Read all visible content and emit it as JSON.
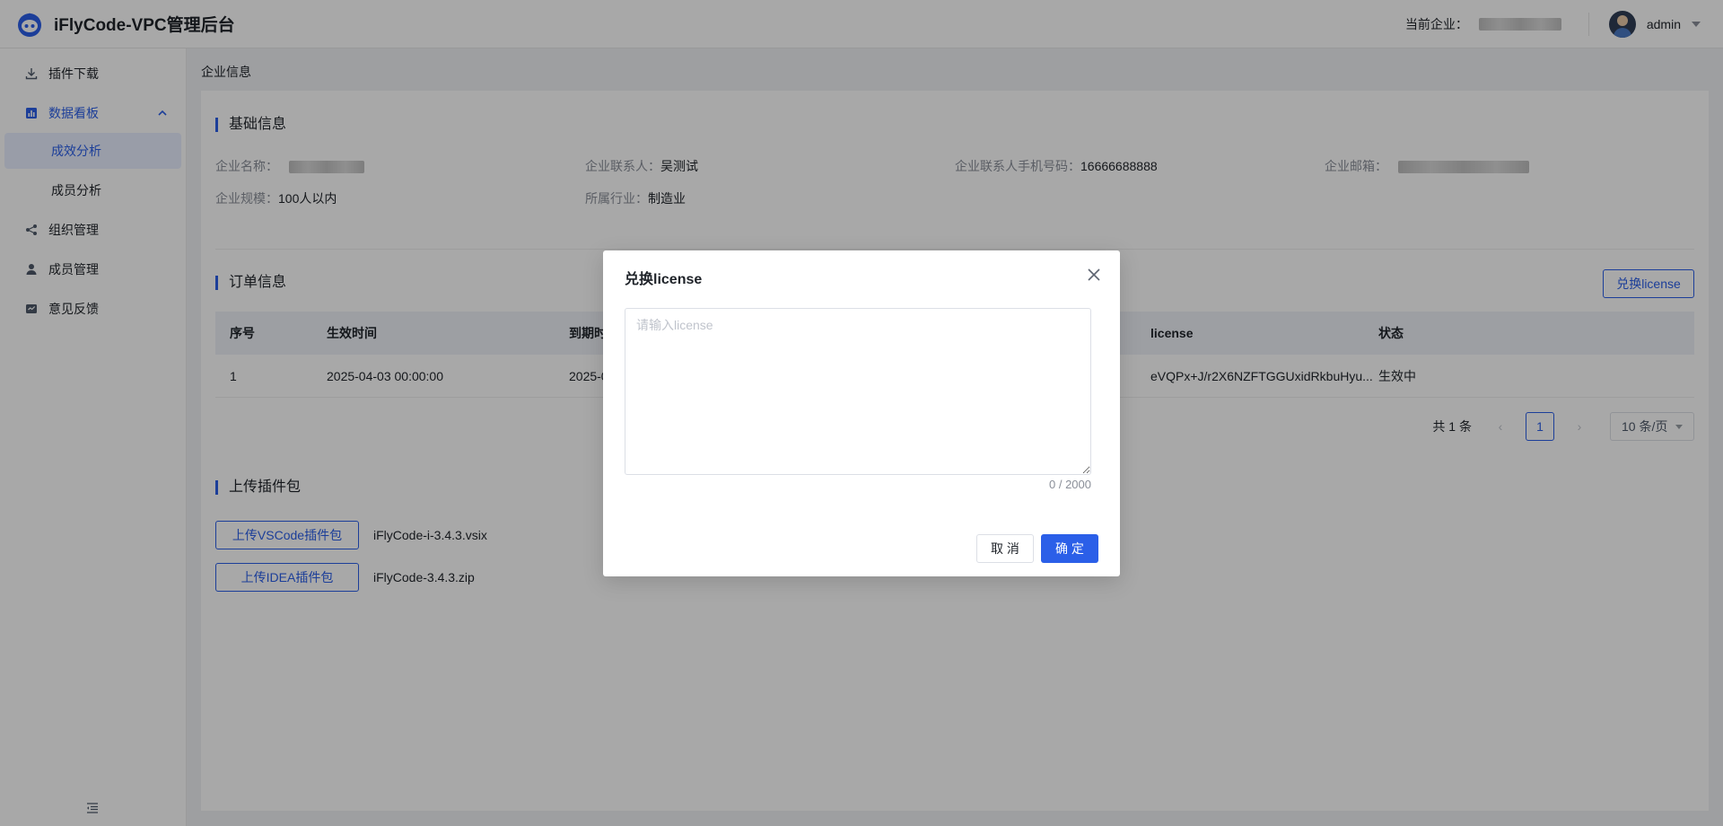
{
  "header": {
    "app_title": "iFlyCode-VPC管理后台",
    "company_label": "当前企业：",
    "user_name": "admin"
  },
  "sidebar": {
    "items": [
      {
        "label": "插件下载",
        "icon": "download-icon"
      },
      {
        "label": "数据看板",
        "icon": "chart-icon",
        "expanded": true,
        "children": [
          {
            "label": "成效分析",
            "active": true
          },
          {
            "label": "成员分析",
            "active": false
          }
        ]
      },
      {
        "label": "组织管理",
        "icon": "share-icon"
      },
      {
        "label": "成员管理",
        "icon": "user-icon"
      },
      {
        "label": "意见反馈",
        "icon": "feedback-icon"
      }
    ]
  },
  "breadcrumb": "企业信息",
  "basic_info": {
    "title": "基础信息",
    "fields": [
      {
        "label": "企业名称：",
        "value": ""
      },
      {
        "label": "企业联系人：",
        "value": "吴测试"
      },
      {
        "label": "企业联系人手机号码：",
        "value": "16666688888"
      },
      {
        "label": "企业邮箱：",
        "value": ""
      },
      {
        "label": "企业规模：",
        "value": "100人以内"
      },
      {
        "label": "所属行业：",
        "value": "制造业"
      }
    ]
  },
  "order_info": {
    "title": "订单信息",
    "redeem_button": "兑换license",
    "columns": [
      "序号",
      "生效时间",
      "到期时",
      "license",
      "状态"
    ],
    "rows": [
      {
        "index": "1",
        "start": "2025-04-03 00:00:00",
        "end": "2025-0",
        "license": "eVQPx+J/r2X6NZFTGGUxidRkbuHyu...",
        "status": "生效中"
      }
    ],
    "pagination": {
      "total": "共 1 条",
      "page": "1",
      "page_size": "10 条/页"
    }
  },
  "upload": {
    "title": "上传插件包",
    "vscode_button": "上传VSCode插件包",
    "vscode_file": "iFlyCode-i-3.4.3.vsix",
    "idea_button": "上传IDEA插件包",
    "idea_file": "iFlyCode-3.4.3.zip"
  },
  "modal": {
    "title": "兑换license",
    "placeholder": "请输入license",
    "value": "",
    "counter": "0 / 2000",
    "cancel_label": "取 消",
    "ok_label": "确 定"
  },
  "colors": {
    "accent": "#2b5fe8",
    "overlay": "rgba(0,0,0,0.34)"
  }
}
